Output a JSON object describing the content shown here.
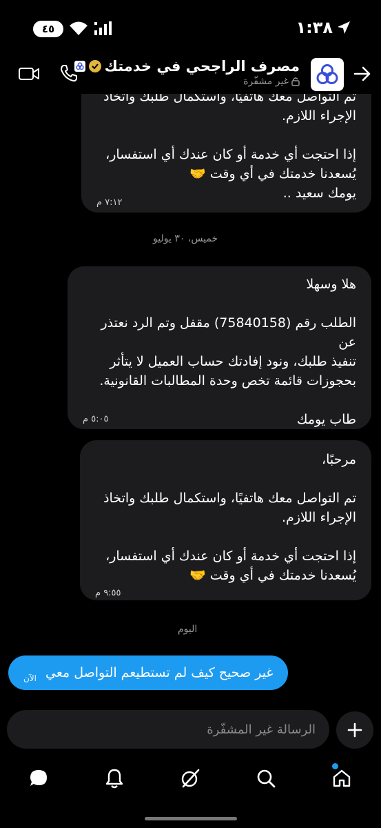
{
  "status_bar": {
    "time": "١:٣٨",
    "battery": "٤٥"
  },
  "header": {
    "title": "مصرف الراجحي في خدمتك",
    "subtitle": "غير مشفّرة"
  },
  "messages": [
    {
      "text": "تم التواصل معك هاتفيًا، واستكمال طلبك واتخاذ\nالإجراء اللازم.\n\nإذا احتجت أي خدمة أو كان عندك أي استفسار،\nيُسعدنا خدمتك في أي وقت 🤝\nيومك سعيد ..",
      "time": "٧:١٢ م"
    },
    {
      "text": "هلا وسهلا\n\nالطلب رقم (75840158) مقفل وتم الرد نعتذر عن\nتنفيذ طلبك، ونود إفادتك حساب العميل لا يتأثر\nبحجوزات قائمة تخص وحدة المطالبات القانونية.\n\nطاب يومك",
      "time": "٥:٠٥ م"
    },
    {
      "text": "مرحبًا،\n\nتم التواصل معك هاتفيًا، واستكمال طلبك واتخاذ\nالإجراء اللازم.\n\nإذا احتجت أي خدمة أو كان عندك أي استفسار،\nيُسعدنا خدمتك في أي وقت 🤝",
      "time": "٩:٥٥ م"
    }
  ],
  "date_separators": {
    "first": "خميس، ٣٠ يوليو",
    "second": "اليوم"
  },
  "outgoing": {
    "text": "غير صحيح كيف لم تستطيعم التواصل معي",
    "time": "الآن"
  },
  "composer": {
    "placeholder": "الرسالة غير المشفّرة"
  },
  "nav": {
    "items": [
      "chat-icon",
      "bell-icon",
      "grok-icon",
      "search-icon",
      "home-icon"
    ]
  },
  "colors": {
    "accent": "#1d9bf0",
    "bubble": "#1c1c1e",
    "brand": "#3a4fd8"
  }
}
